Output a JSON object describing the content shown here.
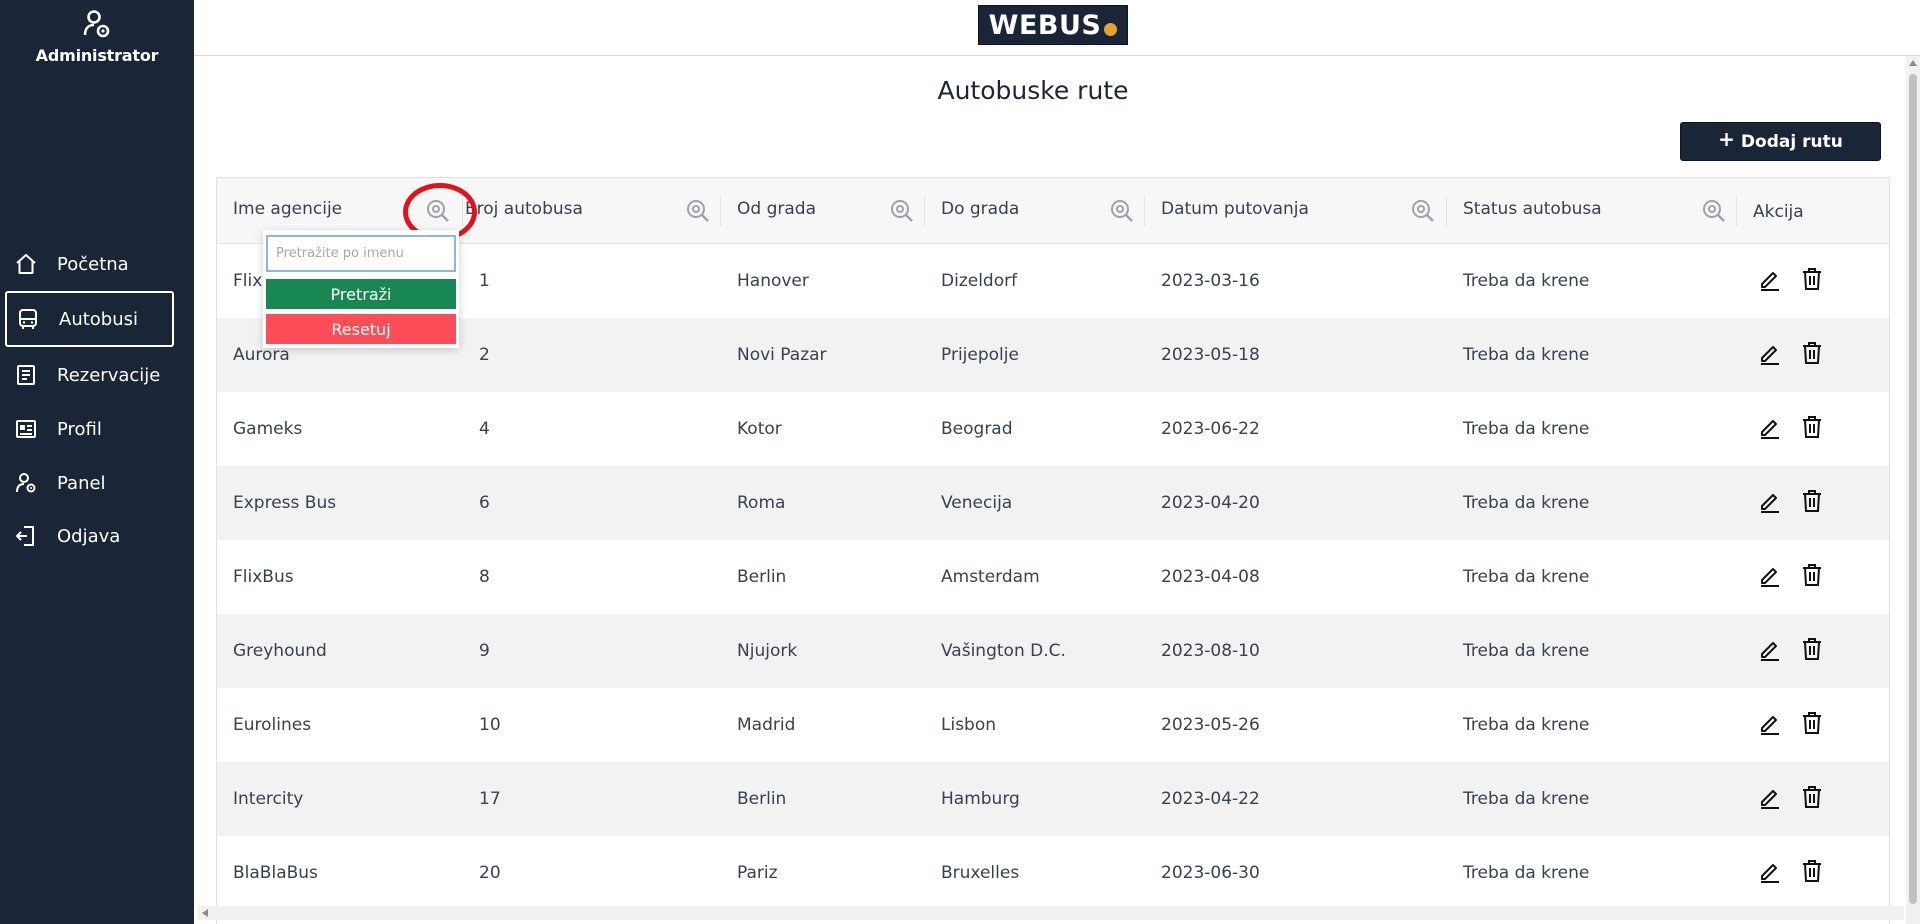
{
  "sidebar": {
    "user_label": "Administrator",
    "items": [
      {
        "label": "Početna",
        "icon": "home-icon"
      },
      {
        "label": "Autobusi",
        "icon": "bus-icon",
        "active": true
      },
      {
        "label": "Rezervacije",
        "icon": "document-icon"
      },
      {
        "label": "Profil",
        "icon": "id-card-icon"
      },
      {
        "label": "Panel",
        "icon": "user-gear-icon"
      },
      {
        "label": "Odjava",
        "icon": "logout-icon"
      }
    ]
  },
  "header": {
    "logo_text": "WEBUS",
    "logo_accent_color": "#e6a032"
  },
  "main": {
    "title": "Autobuske rute",
    "add_button_label": "Dodaj rutu"
  },
  "table": {
    "columns": [
      "Ime agencije",
      "Broj autobusa",
      "Od grada",
      "Do grada",
      "Datum putovanja",
      "Status autobusa",
      "Akcija"
    ],
    "rows": [
      [
        "FlixBus",
        "1",
        "Hanover",
        "Dizeldorf",
        "2023-03-16",
        "Treba da krene"
      ],
      [
        "Aurora",
        "2",
        "Novi Pazar",
        "Prijepolje",
        "2023-05-18",
        "Treba da krene"
      ],
      [
        "Gameks",
        "4",
        "Kotor",
        "Beograd",
        "2023-06-22",
        "Treba da krene"
      ],
      [
        "Express Bus",
        "6",
        "Roma",
        "Venecija",
        "2023-04-20",
        "Treba da krene"
      ],
      [
        "FlixBus",
        "8",
        "Berlin",
        "Amsterdam",
        "2023-04-08",
        "Treba da krene"
      ],
      [
        "Greyhound",
        "9",
        "Njujork",
        "Vašington D.C.",
        "2023-08-10",
        "Treba da krene"
      ],
      [
        "Eurolines",
        "10",
        "Madrid",
        "Lisbon",
        "2023-05-26",
        "Treba da krene"
      ],
      [
        "Intercity",
        "17",
        "Berlin",
        "Hamburg",
        "2023-04-22",
        "Treba da krene"
      ],
      [
        "BlaBlaBus",
        "20",
        "Pariz",
        "Bruxelles",
        "2023-06-30",
        "Treba da krene"
      ]
    ]
  },
  "filter_dropdown": {
    "placeholder": "Pretražite po imenu",
    "search_label": "Pretraži",
    "reset_label": "Resetuj"
  },
  "colors": {
    "sidebar_bg": "#1b2538",
    "search_button": "#198754",
    "reset_button": "#ff4d58",
    "highlight": "#e0121a"
  }
}
